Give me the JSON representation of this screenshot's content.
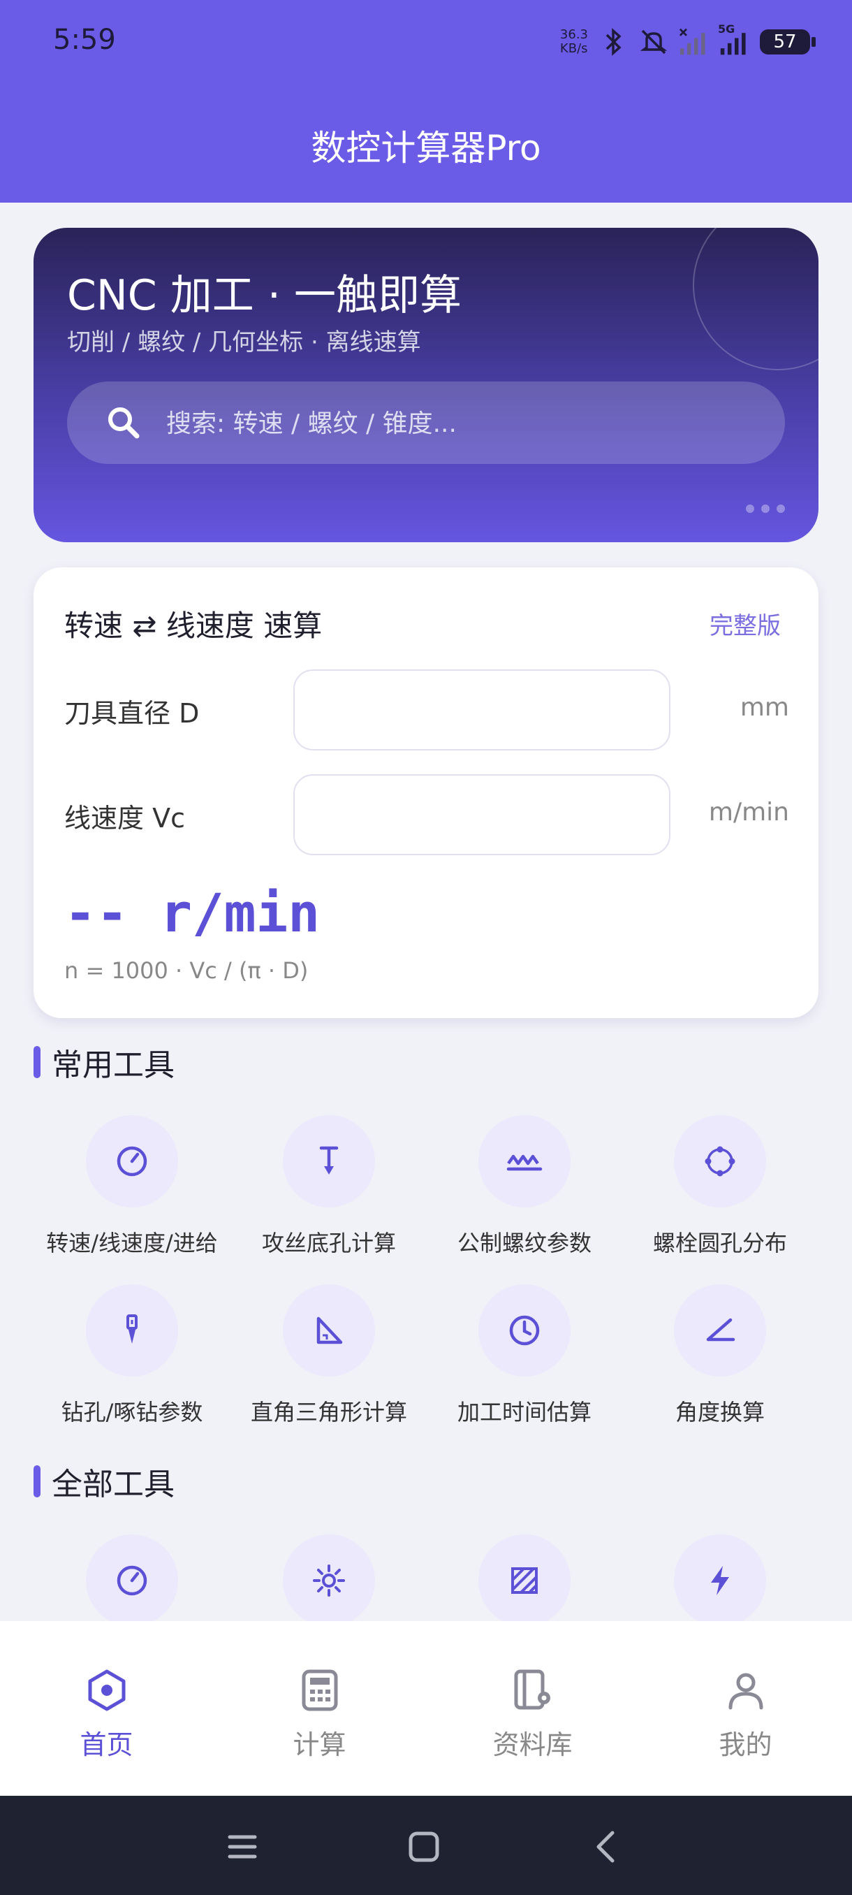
{
  "status_bar": {
    "time": "5:59",
    "net_speed_value": "36.3",
    "net_speed_unit": "KB/s",
    "signal_label": "5G",
    "battery": "57",
    "icons": [
      "bluetooth-icon",
      "mute-icon",
      "signal-off-icon",
      "signal-5g-icon",
      "battery-icon"
    ]
  },
  "app_bar": {
    "title": "数控计算器Pro"
  },
  "hero": {
    "title": "CNC 加工 · 一触即算",
    "subtitle": "切削 / 螺纹 / 几何坐标 · 离线速算",
    "search_placeholder": "搜索: 转速 / 螺纹 / 锥度..."
  },
  "quick_calc": {
    "title": "转速 ⇄ 线速度 速算",
    "link": "完整版",
    "diameter_label": "刀具直径 D",
    "diameter_value": "",
    "diameter_unit": "mm",
    "speed_label": "线速度 Vc",
    "speed_value": "",
    "speed_unit": "m/min",
    "result": "-- r/min",
    "formula": "n = 1000 · Vc / (π · D)"
  },
  "common_tools": {
    "title": "常用工具",
    "items": [
      {
        "label": "转速/线速度/进给",
        "icon": "gauge-icon"
      },
      {
        "label": "攻丝底孔计算",
        "icon": "tap-icon"
      },
      {
        "label": "公制螺纹参数",
        "icon": "thread-icon"
      },
      {
        "label": "螺栓圆孔分布",
        "icon": "bolt-circle-icon"
      },
      {
        "label": "钻孔/啄钻参数",
        "icon": "drill-icon"
      },
      {
        "label": "直角三角形计算",
        "icon": "triangle-icon"
      },
      {
        "label": "加工时间估算",
        "icon": "clock-icon"
      },
      {
        "label": "角度换算",
        "icon": "angle-icon"
      }
    ]
  },
  "all_tools": {
    "title": "全部工具",
    "icons": [
      "gauge-icon",
      "sun-icon",
      "hatch-icon",
      "bolt-icon"
    ]
  },
  "bottom_nav": [
    {
      "label": "首页",
      "icon": "home-hex-icon",
      "active": true
    },
    {
      "label": "计算",
      "icon": "calculator-icon",
      "active": false
    },
    {
      "label": "资料库",
      "icon": "library-icon",
      "active": false
    },
    {
      "label": "我的",
      "icon": "user-icon",
      "active": false
    }
  ],
  "colors": {
    "primary": "#6b5ce7",
    "accent_text": "#5b50d6",
    "background": "#f1f1f8",
    "icon_bg": "#ebe9fb"
  }
}
